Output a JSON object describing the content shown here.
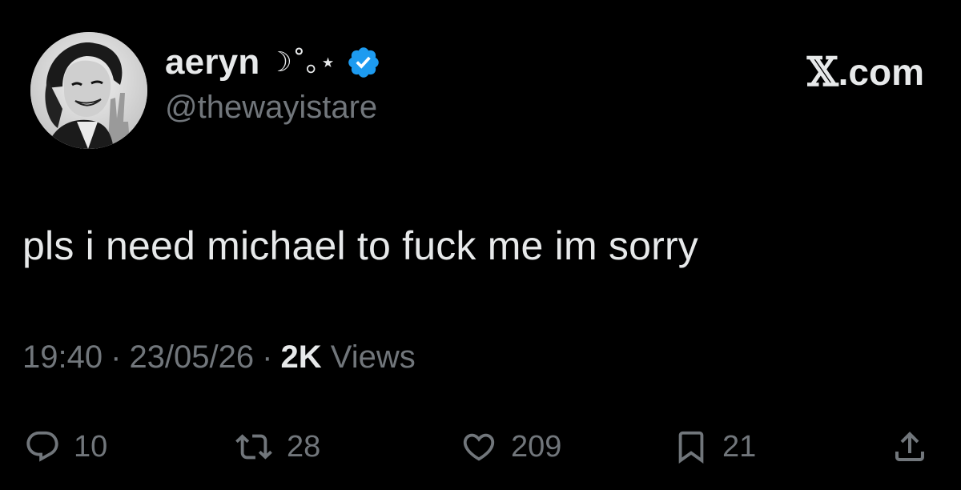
{
  "author": {
    "display_name": "aeryn",
    "display_name_decoration": "☽˚｡⋆",
    "handle": "@thewayistare",
    "verified": true
  },
  "brand": {
    "label": ".com",
    "logo_icon": "x-logo-icon"
  },
  "tweet": {
    "text": "pls i need michael to fuck me im sorry"
  },
  "meta": {
    "time": "19:40",
    "separator": "·",
    "date": "23/05/26",
    "views_count": "2K",
    "views_label": "Views"
  },
  "actions": {
    "reply": {
      "icon": "reply-icon",
      "count": "10"
    },
    "repost": {
      "icon": "repost-icon",
      "count": "28"
    },
    "like": {
      "icon": "heart-icon",
      "count": "209"
    },
    "bookmark": {
      "icon": "bookmark-icon",
      "count": "21"
    },
    "share": {
      "icon": "share-icon"
    }
  },
  "colors": {
    "background": "#000000",
    "primary_text": "#e7e9ea",
    "secondary_text": "#71767b",
    "verified_blue": "#1d9bf0"
  }
}
